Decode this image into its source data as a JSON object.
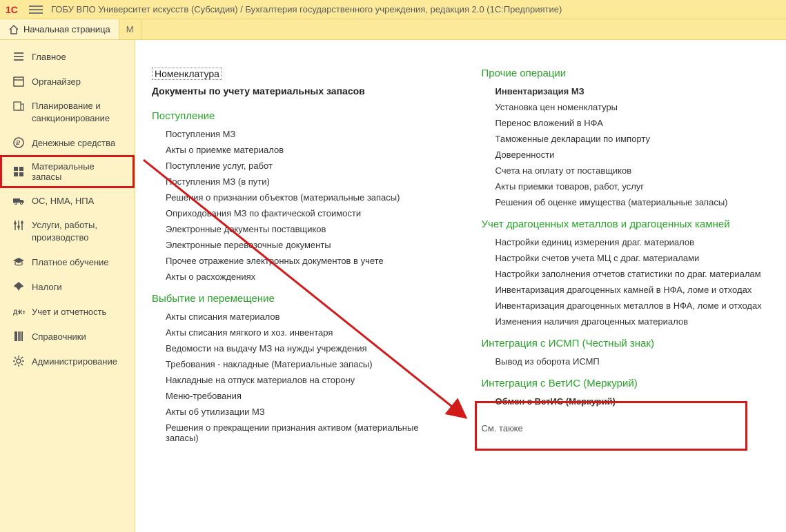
{
  "titlebar": {
    "title": "ГОБУ ВПО Университет искусств (Субсидия) / Бухгалтерия государственного учреждения, редакция 2.0  (1С:Предприятие)"
  },
  "tabs": {
    "home": "Начальная страница",
    "other": "М"
  },
  "sidebar": {
    "items": [
      {
        "label": "Главное",
        "icon": "menu"
      },
      {
        "label": "Органайзер",
        "icon": "calendar"
      },
      {
        "label": "Планирование и\nсанкционирование",
        "icon": "plan",
        "multiline": true
      },
      {
        "label": "Денежные средства",
        "icon": "ruble"
      },
      {
        "label": "Материальные запасы",
        "icon": "grid",
        "active": true
      },
      {
        "label": "ОС, НМА, НПА",
        "icon": "truck"
      },
      {
        "label": "Услуги, работы,\nпроизводство",
        "icon": "sliders",
        "multiline": true
      },
      {
        "label": "Платное обучение",
        "icon": "graduation"
      },
      {
        "label": "Налоги",
        "icon": "eagle"
      },
      {
        "label": "Учет и отчетность",
        "icon": "report"
      },
      {
        "label": "Справочники",
        "icon": "books"
      },
      {
        "label": "Администрирование",
        "icon": "gear"
      }
    ]
  },
  "content": {
    "left": {
      "header_boxed": "Номенклатура",
      "subheader": "Документы по учету материальных запасов",
      "sections": [
        {
          "title": "Поступление",
          "items": [
            "Поступления МЗ",
            "Акты о приемке материалов",
            "Поступление услуг, работ",
            "Поступления МЗ (в пути)",
            "Решения о признании объектов (материальные запасы)",
            "Оприходования МЗ по фактической стоимости",
            "Электронные документы поставщиков",
            "Электронные перевозочные документы",
            "Прочее отражение электронных документов в учете",
            "Акты о расхождениях"
          ]
        },
        {
          "title": "Выбытие и перемещение",
          "items": [
            "Акты списания материалов",
            "Акты списания мягкого и хоз. инвентаря",
            "Ведомости на выдачу МЗ на нужды учреждения",
            "Требования - накладные (Материальные запасы)",
            "Накладные на отпуск материалов на сторону",
            "Меню-требования",
            "Акты об утилизации МЗ",
            "Решения о прекращении признания активом (материальные запасы)"
          ]
        }
      ]
    },
    "right": {
      "sections": [
        {
          "title": "Прочие операции",
          "items": [
            {
              "label": "Инвентаризация МЗ",
              "bold": true
            },
            {
              "label": "Установка цен номенклатуры"
            },
            {
              "label": "Перенос вложений в НФА"
            },
            {
              "label": "Таможенные декларации по импорту"
            },
            {
              "label": "Доверенности"
            },
            {
              "label": "Счета на оплату от поставщиков"
            },
            {
              "label": "Акты приемки товаров, работ, услуг"
            },
            {
              "label": "Решения об оценке имущества (материальные запасы)"
            }
          ]
        },
        {
          "title": "Учет драгоценных металлов и драгоценных камней",
          "items": [
            {
              "label": "Настройки единиц измерения драг. материалов"
            },
            {
              "label": "Настройки счетов учета МЦ с драг. материалами"
            },
            {
              "label": "Настройки заполнения отчетов статистики по драг. материалам"
            },
            {
              "label": "Инвентаризация драгоценных камней в НФА, ломе и отходах"
            },
            {
              "label": "Инвентаризация драгоценных металлов в НФА, ломе и отходах"
            },
            {
              "label": "Изменения наличия драгоценных материалов"
            }
          ]
        },
        {
          "title": "Интеграция с ИСМП (Честный знак)",
          "items": [
            {
              "label": "Вывод из оборота ИСМП"
            }
          ]
        },
        {
          "title": "Интеграция с ВетИС (Меркурий)",
          "items": [
            {
              "label": "Обмен с ВетИС (Меркурий)",
              "bold": true
            }
          ]
        }
      ],
      "footer": "См. также"
    }
  }
}
